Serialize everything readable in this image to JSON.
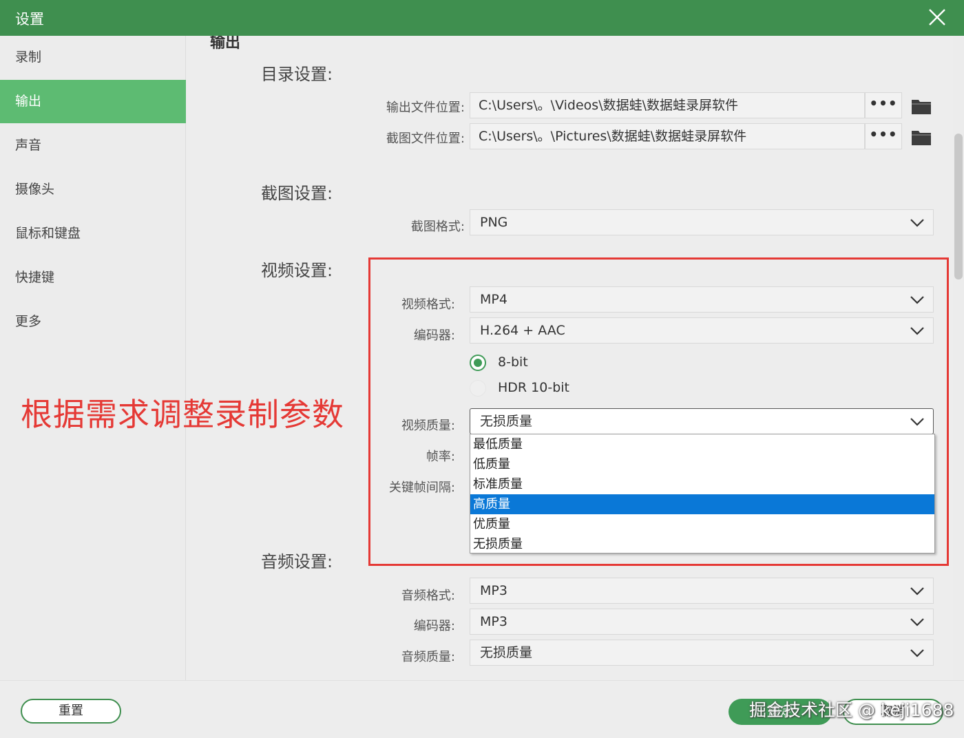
{
  "window": {
    "title": "设置"
  },
  "sidebar": {
    "items": [
      {
        "label": "录制"
      },
      {
        "label": "输出"
      },
      {
        "label": "声音"
      },
      {
        "label": "摄像头"
      },
      {
        "label": "鼠标和键盘"
      },
      {
        "label": "快捷键"
      },
      {
        "label": "更多"
      }
    ],
    "active_index": 1
  },
  "output": {
    "heading": "输出",
    "directory": {
      "title": "目录设置:",
      "output_label": "输出文件位置:",
      "output_path": "C:\\Users\\。\\Videos\\数据蛙\\数据蛙录屏软件",
      "screenshot_label": "截图文件位置:",
      "screenshot_path": "C:\\Users\\。\\Pictures\\数据蛙\\数据蛙录屏软件",
      "browse_label": "•••"
    },
    "screenshot": {
      "title": "截图设置:",
      "format_label": "截图格式:",
      "format_value": "PNG"
    },
    "video": {
      "title": "视频设置:",
      "format_label": "视频格式:",
      "format_value": "MP4",
      "encoder_label": "编码器:",
      "encoder_value": "H.264 + AAC",
      "bit_8_label": "8-bit",
      "hdr_label": "HDR 10-bit",
      "selected_bit": "8-bit",
      "quality_label": "视频质量:",
      "quality_value": "无损质量",
      "framerate_label": "帧率:",
      "keyframe_label": "关键帧间隔:",
      "quality_options": [
        "最低质量",
        "低质量",
        "标准质量",
        "高质量",
        "优质量",
        "无损质量"
      ],
      "highlighted_option": "高质量"
    },
    "audio": {
      "title": "音频设置:",
      "format_label": "音频格式:",
      "format_value": "MP3",
      "encoder_label": "编码器:",
      "encoder_value": "MP3",
      "quality_label": "音频质量:",
      "quality_value": "无损质量"
    }
  },
  "annotation": {
    "text": "根据需求调整录制参数"
  },
  "footer": {
    "reset_label": "重置",
    "ok_label": "确定",
    "cancel_label": "取消",
    "watermark": "掘金技术社区 @ keji1688"
  },
  "colors": {
    "titlebar": "#3f8f4f",
    "sidebar_active": "#5dbb72",
    "accent_green": "#3f9b57",
    "selection_blue": "#0a78d7",
    "annotation_red": "#e53935"
  },
  "icons": {
    "close": "close-icon",
    "folder": "folder-icon",
    "chevron": "chevron-down-icon"
  }
}
